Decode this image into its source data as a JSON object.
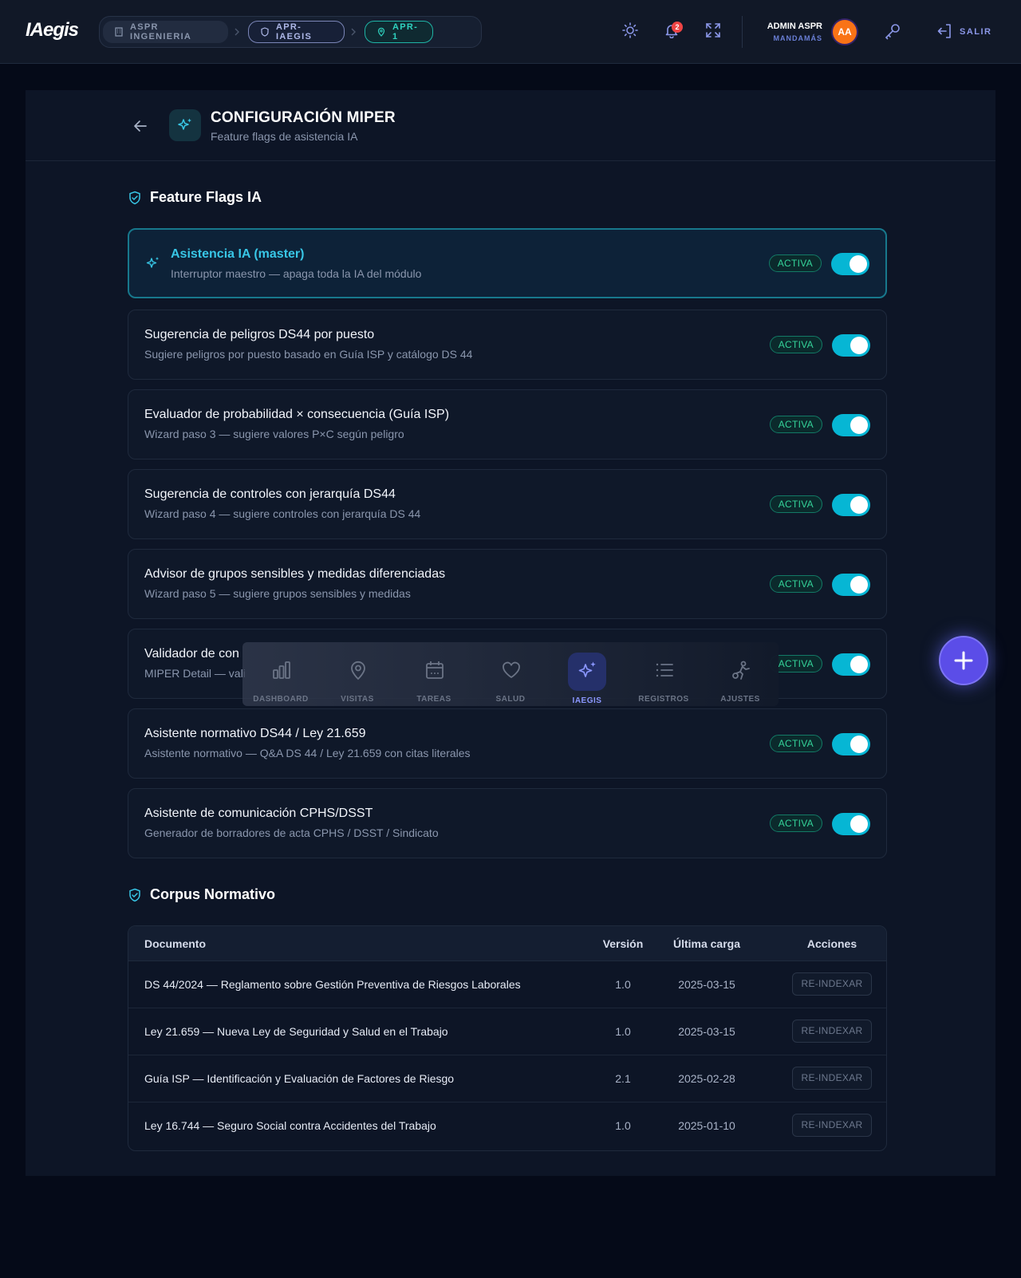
{
  "header": {
    "logo": "IAegis",
    "breadcrumbs": [
      "ASPR INGENIERIA",
      "APR-IAEGIS",
      "APR-1"
    ],
    "notification_count": "2",
    "user_name": "ADMIN ASPR",
    "user_role": "MANDAMÁS",
    "avatar_initials": "AA",
    "logout_label": "SALIR"
  },
  "page": {
    "title": "CONFIGURACIÓN MIPER",
    "subtitle": "Feature flags de asistencia IA"
  },
  "flags_section": {
    "title": "Feature Flags IA",
    "items": [
      {
        "title": "Asistencia IA (master)",
        "description": "Interruptor maestro — apaga toda la IA del módulo",
        "status": "ACTIVA",
        "enabled": true
      },
      {
        "title": "Sugerencia de peligros DS44 por puesto",
        "description": "Sugiere peligros por puesto basado en Guía ISP y catálogo DS 44",
        "status": "ACTIVA",
        "enabled": true
      },
      {
        "title": "Evaluador de probabilidad × consecuencia (Guía ISP)",
        "description": "Wizard paso 3 — sugiere valores P×C según peligro",
        "status": "ACTIVA",
        "enabled": true
      },
      {
        "title": "Sugerencia de controles con jerarquía DS44",
        "description": "Wizard paso 4 — sugiere controles con jerarquía DS 44",
        "status": "ACTIVA",
        "enabled": true
      },
      {
        "title": "Advisor de grupos sensibles y medidas diferenciadas",
        "description": "Wizard paso 5 — sugiere grupos sensibles y medidas",
        "status": "ACTIVA",
        "enabled": true
      },
      {
        "title": "Validador de con",
        "description": "MIPER Detail — vali",
        "status": "ACTIVA",
        "enabled": true
      },
      {
        "title": "Asistente normativo DS44 / Ley 21.659",
        "description": "Asistente normativo — Q&A DS 44 / Ley 21.659 con citas literales",
        "status": "ACTIVA",
        "enabled": true
      },
      {
        "title": "Asistente de comunicación CPHS/DSST",
        "description": "Generador de borradores de acta CPHS / DSST / Sindicato",
        "status": "ACTIVA",
        "enabled": true
      }
    ]
  },
  "corpus_section": {
    "title": "Corpus Normativo",
    "columns": [
      "Documento",
      "Versión",
      "Última carga",
      "Acciones"
    ],
    "rows": [
      {
        "documento": "DS 44/2024 — Reglamento sobre Gestión Preventiva de Riesgos Laborales",
        "version": "1.0",
        "fecha": "2025-03-15",
        "accion": "RE-INDEXAR"
      },
      {
        "documento": "Ley 21.659 — Nueva Ley de Seguridad y Salud en el Trabajo",
        "version": "1.0",
        "fecha": "2025-03-15",
        "accion": "RE-INDEXAR"
      },
      {
        "documento": "Guía ISP — Identificación y Evaluación de Factores de Riesgo",
        "version": "2.1",
        "fecha": "2025-02-28",
        "accion": "RE-INDEXAR"
      },
      {
        "documento": "Ley 16.744 — Seguro Social contra Accidentes del Trabajo",
        "version": "1.0",
        "fecha": "2025-01-10",
        "accion": "RE-INDEXAR"
      }
    ]
  },
  "dock": {
    "items": [
      {
        "label": "DASHBOARD",
        "icon": "bar-chart-icon"
      },
      {
        "label": "VISITAS",
        "icon": "map-pin-icon"
      },
      {
        "label": "TAREAS",
        "icon": "calendar-icon"
      },
      {
        "label": "SALUD",
        "icon": "heart-icon"
      },
      {
        "label": "IAEGIS",
        "icon": "sparkles-icon",
        "active": true
      },
      {
        "label": "REGISTROS",
        "icon": "list-icon"
      },
      {
        "label": "AJUSTES",
        "icon": "settings-figure-icon"
      }
    ]
  },
  "colors": {
    "accent": "#06b6d4",
    "active_pill": "#34d399",
    "brand_indigo": "#5b4de8"
  }
}
